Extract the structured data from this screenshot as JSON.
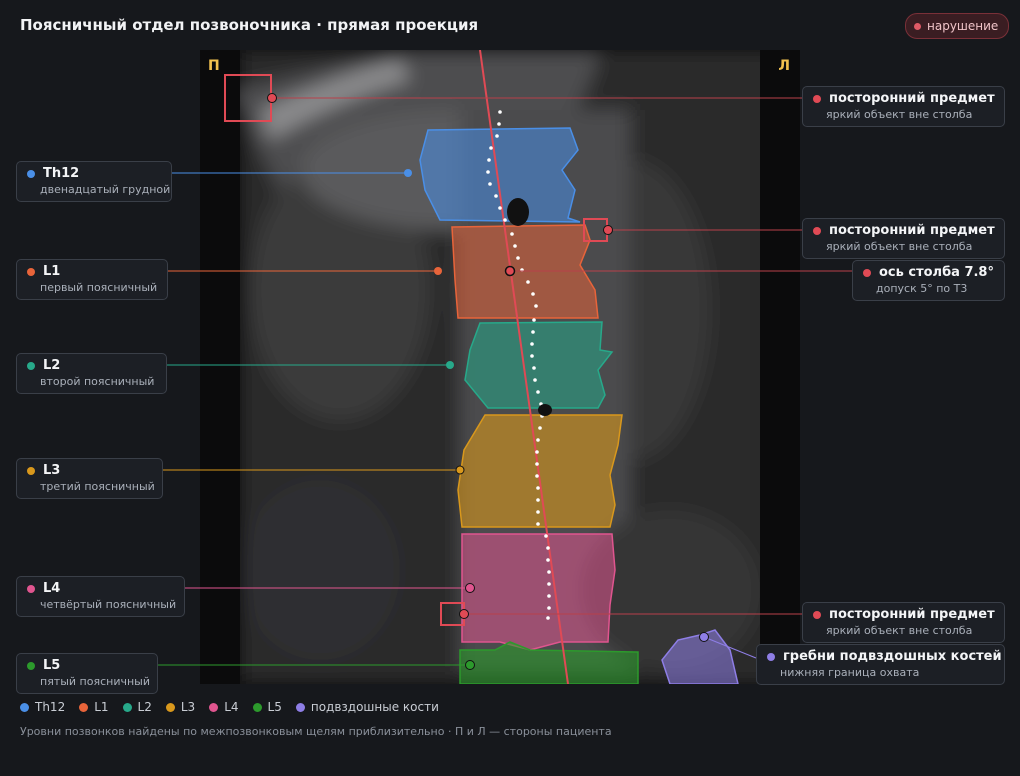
{
  "header": {
    "title": "Поясничный отдел позвоночника · прямая проекция",
    "badge": "нарушение"
  },
  "image": {
    "side_right": "П",
    "side_left": "Л"
  },
  "colors": {
    "Th12": "#4a8fe7",
    "L1": "#e8643a",
    "L2": "#27a98a",
    "L3": "#d9981c",
    "L4": "#e0558f",
    "L5": "#2c9a2c",
    "iliac": "#8e7ee6",
    "alert": "#e04a55"
  },
  "vertebrae": [
    {
      "key": "Th12",
      "name": "Th12",
      "desc": "двенадцатый грудной"
    },
    {
      "key": "L1",
      "name": "L1",
      "desc": "первый поясничный"
    },
    {
      "key": "L2",
      "name": "L2",
      "desc": "второй поясничный"
    },
    {
      "key": "L3",
      "name": "L3",
      "desc": "третий поясничный"
    },
    {
      "key": "L4",
      "name": "L4",
      "desc": "четвёртый поясничный"
    },
    {
      "key": "L5",
      "name": "L5",
      "desc": "пятый поясничный"
    }
  ],
  "findings": {
    "foreign_1": {
      "name": "посторонний предмет",
      "desc": "яркий объект вне столба"
    },
    "foreign_2": {
      "name": "посторонний предмет",
      "desc": "яркий объект вне столба"
    },
    "axis": {
      "name": "ось столба 7.8°",
      "desc": "допуск 5° по Т3"
    },
    "foreign_3": {
      "name": "посторонний предмет",
      "desc": "яркий объект вне столба"
    },
    "iliac": {
      "name": "гребни подвздошных костей",
      "desc": "нижняя граница охвата"
    }
  },
  "legend": [
    {
      "label": "Th12",
      "color_key": "Th12"
    },
    {
      "label": "L1",
      "color_key": "L1"
    },
    {
      "label": "L2",
      "color_key": "L2"
    },
    {
      "label": "L3",
      "color_key": "L3"
    },
    {
      "label": "L4",
      "color_key": "L4"
    },
    {
      "label": "L5",
      "color_key": "L5"
    },
    {
      "label": "подвздошные кости",
      "color_key": "iliac"
    }
  ],
  "footnote": "Уровни позвонков найдены по межпозвонковым щелям приблизительно · П и Л — стороны пациента"
}
